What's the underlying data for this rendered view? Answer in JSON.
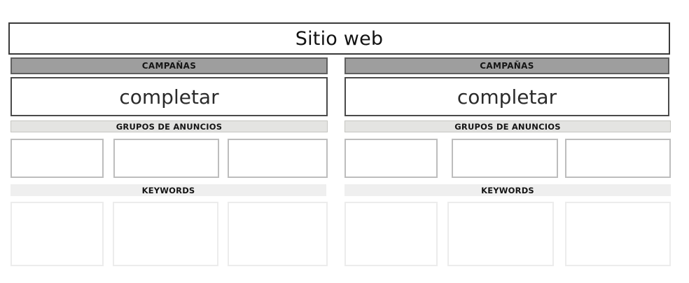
{
  "site": {
    "label": "Sitio web"
  },
  "columns": [
    {
      "campaign_header": "CAMPAÑAS",
      "campaign_value": "completar",
      "groups_header": "GRUPOS DE ANUNCIOS",
      "keywords_header": "KEYWORDS"
    },
    {
      "campaign_header": "CAMPAÑAS",
      "campaign_value": "completar",
      "groups_header": "GRUPOS DE ANUNCIOS",
      "keywords_header": "KEYWORDS"
    }
  ]
}
